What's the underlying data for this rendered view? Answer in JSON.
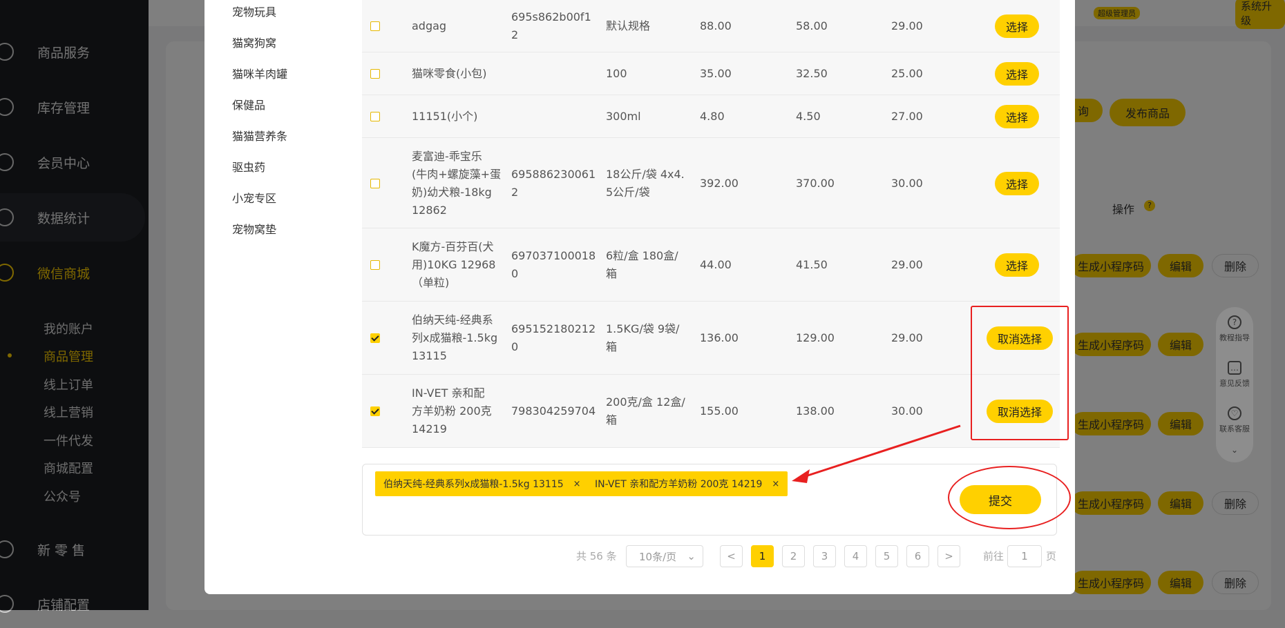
{
  "sidebar": {
    "items": [
      {
        "label": "商品服务"
      },
      {
        "label": "库存管理"
      },
      {
        "label": "会员中心"
      },
      {
        "label": "数据统计"
      },
      {
        "label": "微信商城"
      },
      {
        "label": "新 零 售"
      },
      {
        "label": "店铺配置"
      }
    ],
    "sub_items": [
      {
        "label": "我的账户"
      },
      {
        "label": "商品管理"
      },
      {
        "label": "线上订单"
      },
      {
        "label": "线上营销"
      },
      {
        "label": "一件代发"
      },
      {
        "label": "商城配置"
      },
      {
        "label": "公众号"
      }
    ]
  },
  "topbar": {
    "role_badge": "超级管理员",
    "upgrade_label": "系统升级"
  },
  "background": {
    "query_btn": "询",
    "publish_btn": "发布商品",
    "ops_header": "操作",
    "qrcode_btn": "生成小程序码",
    "edit_btn": "编辑",
    "delete_btn": "删除"
  },
  "helper": {
    "tutorial": "教程指导",
    "feedback": "意见反馈",
    "service": "联系客服"
  },
  "modal": {
    "categories": [
      "宠物玩具",
      "猫窝狗窝",
      "猫咪羊肉罐",
      "保健品",
      "猫猫营养条",
      "驱虫药",
      "小宠专区",
      "宠物窝垫"
    ],
    "rows": [
      {
        "name": [
          "adgag"
        ],
        "barcode": [
          "695s862b00f1",
          "2"
        ],
        "spec": [
          "默认规格"
        ],
        "price1": "88.00",
        "price2": "58.00",
        "stock": "29.00",
        "action": "选择",
        "checked": false
      },
      {
        "name": [
          "猫咪零食(小包)"
        ],
        "barcode": [],
        "spec": [
          "100"
        ],
        "price1": "35.00",
        "price2": "32.50",
        "stock": "25.00",
        "action": "选择",
        "checked": false
      },
      {
        "name": [
          "11151(小个)"
        ],
        "barcode": [],
        "spec": [
          "300ml"
        ],
        "price1": "4.80",
        "price2": "4.50",
        "stock": "27.00",
        "action": "选择",
        "checked": false
      },
      {
        "name": [
          "麦富迪-乖宝乐",
          "(牛肉+螺旋藻+蛋",
          "奶)幼犬粮-18kg",
          "12862"
        ],
        "barcode": [
          "695886230061",
          "2"
        ],
        "spec": [
          "18公斤/袋 4x4.",
          "5公斤/袋"
        ],
        "price1": "392.00",
        "price2": "370.00",
        "stock": "30.00",
        "action": "选择",
        "checked": false
      },
      {
        "name": [
          "K魔方-百芬百(犬",
          "用)10KG 12968",
          "（单粒)"
        ],
        "barcode": [
          "697037100018",
          "0"
        ],
        "spec": [
          "6粒/盒 180盒/",
          "箱"
        ],
        "price1": "44.00",
        "price2": "41.50",
        "stock": "29.00",
        "action": "选择",
        "checked": false
      },
      {
        "name": [
          "伯纳天纯-经典系",
          "列x成猫粮-1.5kg",
          "13115"
        ],
        "barcode": [
          "695152180212",
          "0"
        ],
        "spec": [
          "1.5KG/袋 9袋/",
          "箱"
        ],
        "price1": "136.00",
        "price2": "129.00",
        "stock": "29.00",
        "action": "取消选择",
        "checked": true
      },
      {
        "name": [
          "IN-VET 亲和配",
          "方羊奶粉 200克",
          "14219"
        ],
        "barcode": [
          "798304259704"
        ],
        "spec": [
          "200克/盒 12盒/",
          "箱"
        ],
        "price1": "155.00",
        "price2": "138.00",
        "stock": "30.00",
        "action": "取消选择",
        "checked": true
      }
    ],
    "selected_tags": [
      {
        "label": "伯纳天纯-经典系列x成猫粮-1.5kg 13115"
      },
      {
        "label": "IN-VET 亲和配方羊奶粉 200克 14219"
      }
    ],
    "tag_close": "×",
    "submit_label": "提交",
    "pagination": {
      "total": "共 56 条",
      "page_size": "10条/页",
      "prev": "<",
      "next": ">",
      "pages": [
        "1",
        "2",
        "3",
        "4",
        "5",
        "6"
      ],
      "current": "1",
      "goto_prefix": "前往",
      "goto_value": "1",
      "goto_suffix": "页"
    }
  },
  "colors": {
    "accent": "#ffd000",
    "annotation": "#e82020",
    "sidebar_bg": "#1b1d21"
  }
}
